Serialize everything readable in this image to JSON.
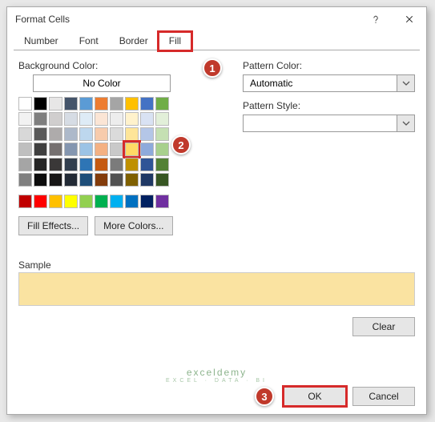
{
  "title": "Format Cells",
  "tabs": {
    "number": "Number",
    "font": "Font",
    "border": "Border",
    "fill": "Fill"
  },
  "labels": {
    "bgcolor": "Background Color:",
    "nocolor": "No Color",
    "filleffects": "Fill Effects...",
    "morecolors": "More Colors...",
    "pcolor": "Pattern Color:",
    "pcolor_val": "Automatic",
    "pstyle": "Pattern Style:",
    "sample": "Sample",
    "clear": "Clear",
    "ok": "OK",
    "cancel": "Cancel"
  },
  "badges": {
    "b1": "1",
    "b2": "2",
    "b3": "3"
  },
  "watermark": {
    "main": "exceldemy",
    "sub": "EXCEL · DATA · BI"
  },
  "sample_color": "#fae3a1",
  "swatch_rows": {
    "r1": [
      "#ffffff",
      "#000000",
      "#e7e6e6",
      "#44546a",
      "#5b9bd5",
      "#ed7d31",
      "#a5a5a5",
      "#ffc000",
      "#4472c4",
      "#70ad47"
    ],
    "r2": [
      "#f2f2f2",
      "#7f7f7f",
      "#d0cece",
      "#d6dce4",
      "#deebf6",
      "#fbe5d5",
      "#ededed",
      "#fff2cc",
      "#d9e2f3",
      "#e2efd9"
    ],
    "r3": [
      "#d8d8d8",
      "#595959",
      "#aeabab",
      "#adb9ca",
      "#bdd7ee",
      "#f7cbac",
      "#dbdbdb",
      "#fee599",
      "#b4c6e7",
      "#c5e0b3"
    ],
    "r4": [
      "#bfbfbf",
      "#3f3f3f",
      "#757070",
      "#8496b0",
      "#9cc3e5",
      "#f4b183",
      "#c9c9c9",
      "#ffd965",
      "#8eaadb",
      "#a8d08d"
    ],
    "r5": [
      "#a5a5a5",
      "#262626",
      "#3a3838",
      "#323f4f",
      "#2e75b5",
      "#c55a11",
      "#7b7b7b",
      "#bf9000",
      "#2f5496",
      "#538135"
    ],
    "r6": [
      "#7f7f7f",
      "#0c0c0c",
      "#171616",
      "#222a35",
      "#1e4e79",
      "#833c0b",
      "#525252",
      "#7f6000",
      "#1f3864",
      "#375623"
    ],
    "std": [
      "#c00000",
      "#ff0000",
      "#ffc000",
      "#ffff00",
      "#92d050",
      "#00b050",
      "#00b0f0",
      "#0070c0",
      "#002060",
      "#7030a0"
    ]
  }
}
